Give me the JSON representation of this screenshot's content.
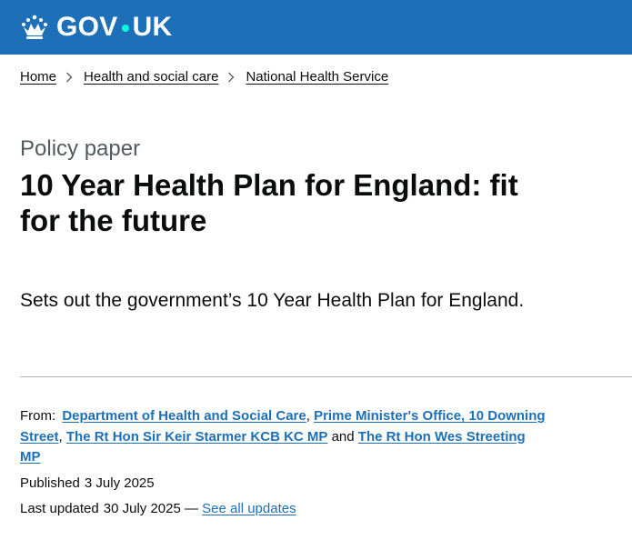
{
  "header": {
    "logo_text_left": "GOV",
    "logo_text_right": "UK",
    "logo_icon": "crown-icon",
    "colors": {
      "bar": "#1d70b8",
      "dot": "#00ffe0"
    }
  },
  "breadcrumbs": [
    {
      "label": "Home"
    },
    {
      "label": "Health and social care"
    },
    {
      "label": "National Health Service"
    }
  ],
  "page": {
    "caption": "Policy paper",
    "title": "10 Year Health Plan for England: fit for the future",
    "lead": "Sets out the government’s 10 Year Health Plan for England."
  },
  "metadata": {
    "from_label": "From:",
    "from_orgs": [
      "Department of Health and Social Care",
      "Prime Minister's Office, 10 Downing Street",
      "The Rt Hon Sir Keir Starmer KCB KC MP",
      "The Rt Hon Wes Streeting MP"
    ],
    "separator_comma": ",",
    "separator_and": "and",
    "published_label": "Published",
    "published_date": "3 July 2025",
    "updated_label": "Last updated",
    "updated_date": "30 July 2025",
    "updated_dash": "—",
    "see_all_label": "See all updates"
  },
  "colors": {
    "link": "#1d70b8",
    "text": "#0b0c0c",
    "secondary_text": "#505a5f",
    "border": "#b1b4b6"
  }
}
